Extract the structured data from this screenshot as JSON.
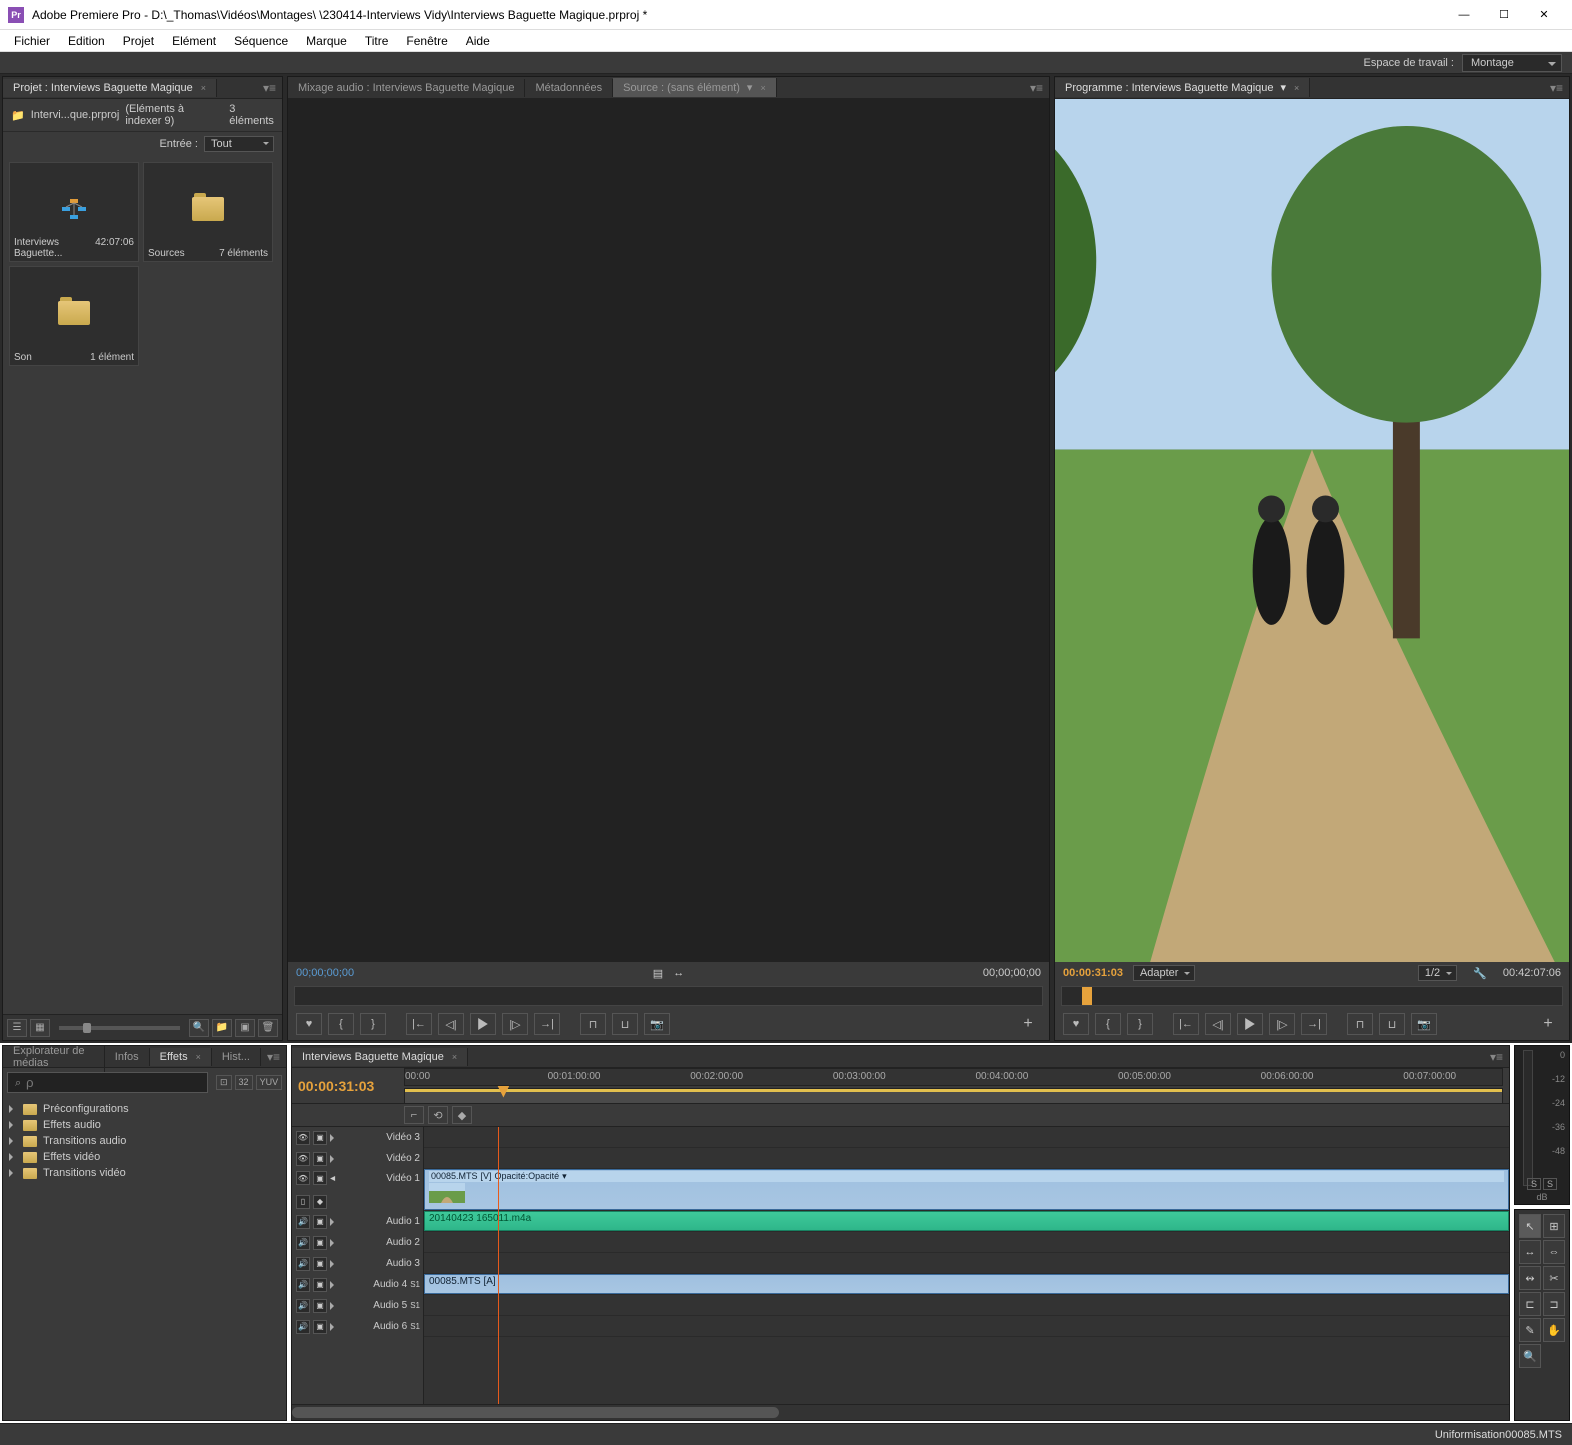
{
  "titlebar": {
    "app": "Adobe Premiere Pro",
    "path": "D:\\_Thomas\\Vidéos\\Montages\\                \\230414-Interviews Vidy\\Interviews Baguette Magique.prproj *"
  },
  "menu": [
    "Fichier",
    "Edition",
    "Projet",
    "Elément",
    "Séquence",
    "Marque",
    "Titre",
    "Fenêtre",
    "Aide"
  ],
  "workspace": {
    "label": "Espace de travail :",
    "value": "Montage"
  },
  "project": {
    "tab": "Projet : Interviews Baguette Magique",
    "info_file": "Intervi...que.prproj",
    "info_index": "(Eléments à indexer 9)",
    "info_count": "3 éléments",
    "filter_label": "Entrée :",
    "filter_value": "Tout",
    "bins": [
      {
        "name": "Interviews Baguette...",
        "meta": "42:07:06",
        "type": "sequence"
      },
      {
        "name": "Sources",
        "meta": "7 éléments",
        "type": "folder"
      },
      {
        "name": "Son",
        "meta": "1 élément",
        "type": "folder"
      }
    ]
  },
  "source": {
    "tabs": [
      {
        "label": "Mixage audio : Interviews Baguette Magique",
        "active": false
      },
      {
        "label": "Métadonnées",
        "active": false
      },
      {
        "label": "Source : (sans élément)",
        "active": true
      }
    ],
    "tc_in": "00;00;00;00",
    "tc_out": "00;00;00;00"
  },
  "program": {
    "tab": "Programme : Interviews Baguette Magique",
    "tc_pos": "00:00:31:03",
    "fit": "Adapter",
    "zoom": "1/2",
    "duration": "00:42:07:06"
  },
  "effects": {
    "tabs": [
      "Explorateur de médias",
      "Infos",
      "Effets",
      "Hist..."
    ],
    "active_tab": 2,
    "search_placeholder": "ρ",
    "badges": [
      "⊡",
      "32",
      "YUV"
    ],
    "tree": [
      "Préconfigurations",
      "Effets audio",
      "Transitions audio",
      "Effets vidéo",
      "Transitions vidéo"
    ]
  },
  "timeline": {
    "tab": "Interviews Baguette Magique",
    "tc": "00:00:31:03",
    "ruler_ticks": [
      "00:00",
      "00:01:00:00",
      "00:02:00:00",
      "00:03:00:00",
      "00:04:00:00",
      "00:05:00:00",
      "00:06:00:00",
      "00:07:00:00"
    ],
    "tracks": [
      {
        "type": "video",
        "label": "Vidéo 3"
      },
      {
        "type": "video",
        "label": "Vidéo 2"
      },
      {
        "type": "video",
        "label": "Vidéo 1",
        "tall": true,
        "clip": {
          "name": "00085.MTS",
          "badge": "[V]",
          "fx": "Opacité:Opacité"
        }
      },
      {
        "type": "audio",
        "label": "Audio 1",
        "clip": {
          "name": "20140423 165011.m4a",
          "style": "green"
        }
      },
      {
        "type": "audio",
        "label": "Audio 2"
      },
      {
        "type": "audio",
        "label": "Audio 3"
      },
      {
        "type": "audio",
        "label": "Audio 4",
        "badge": "S1",
        "clip": {
          "name": "00085.MTS",
          "tag": "[A]",
          "style": "blue"
        }
      },
      {
        "type": "audio",
        "label": "Audio 5",
        "badge": "S1"
      },
      {
        "type": "audio",
        "label": "Audio 6",
        "badge": "S1"
      }
    ]
  },
  "meter": {
    "scale": [
      "0",
      "-12",
      "-24",
      "-36",
      "-48"
    ],
    "unit": "dB",
    "btns": [
      "S",
      "S"
    ]
  },
  "status": "Uniformisation00085.MTS"
}
